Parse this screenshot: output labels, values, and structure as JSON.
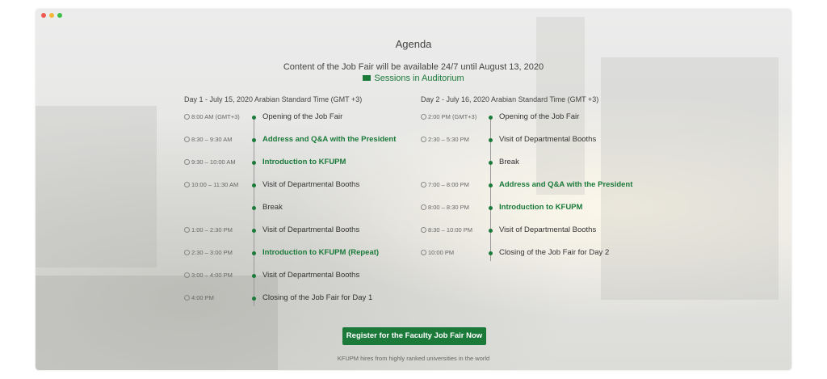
{
  "page": {
    "title": "Agenda",
    "subtitle": "Content of the Job Fair will be available 24/7 until August 13, 2020",
    "legend_label": "Sessions in Auditorium",
    "accent_color": "#1b7a3a"
  },
  "day1": {
    "heading": "Day 1 - July 15, 2020 Arabian Standard Time (GMT +3)",
    "items": [
      {
        "time": "8:00 AM (GMT+3)",
        "label": "Opening of the Job Fair",
        "highlight": false
      },
      {
        "time": "8:30 – 9:30 AM",
        "label": "Address and Q&A with the President",
        "highlight": true
      },
      {
        "time": "9:30 – 10:00 AM",
        "label": "Introduction to KFUPM",
        "highlight": true
      },
      {
        "time": "10:00 – 11:30 AM",
        "label": "Visit of Departmental Booths",
        "highlight": false
      },
      {
        "time": "",
        "label": "Break",
        "highlight": false
      },
      {
        "time": "1:00 – 2:30 PM",
        "label": "Visit of Departmental Booths",
        "highlight": false
      },
      {
        "time": "2:30 – 3:00 PM",
        "label": "Introduction to KFUPM (Repeat)",
        "highlight": true
      },
      {
        "time": "3:00 – 4:00 PM",
        "label": "Visit of Departmental Booths",
        "highlight": false
      },
      {
        "time": "4:00 PM",
        "label": "Closing of the Job Fair for Day 1",
        "highlight": false
      }
    ]
  },
  "day2": {
    "heading": "Day 2 - July 16, 2020 Arabian Standard Time (GMT +3)",
    "items": [
      {
        "time": "2:00 PM (GMT+3)",
        "label": "Opening of the Job Fair",
        "highlight": false
      },
      {
        "time": "2:30 – 5:30 PM",
        "label": "Visit of Departmental Booths",
        "highlight": false
      },
      {
        "time": "",
        "label": "Break",
        "highlight": false
      },
      {
        "time": "7:00 – 8:00 PM",
        "label": "Address and Q&A with the President",
        "highlight": true
      },
      {
        "time": "8:00 – 8:30 PM",
        "label": "Introduction to KFUPM",
        "highlight": true
      },
      {
        "time": "8:30 – 10:00 PM",
        "label": "Visit of Departmental Booths",
        "highlight": false
      },
      {
        "time": "10:00 PM",
        "label": "Closing of the Job Fair for Day 2",
        "highlight": false
      }
    ]
  },
  "cta": {
    "register_label": "Register for the Faculty Job Fair Now",
    "footer_text": "KFUPM hires from highly ranked universities in the world"
  }
}
